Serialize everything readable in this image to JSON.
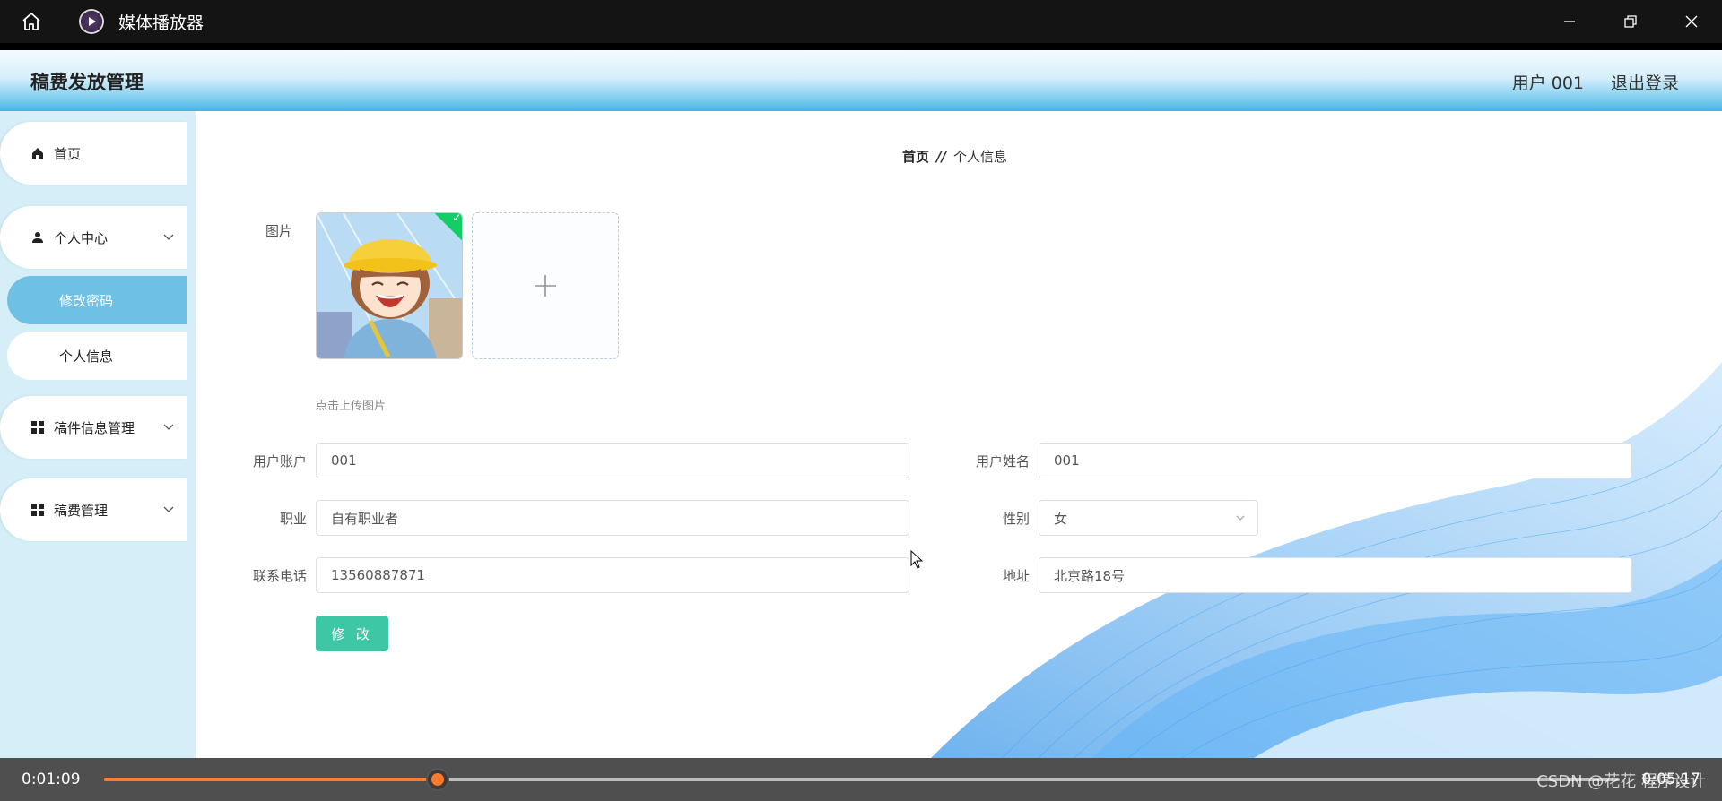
{
  "titlebar": {
    "app_name": "媒体播放器"
  },
  "header": {
    "title": "稿费发放管理",
    "user": "用户 001",
    "logout": "退出登录"
  },
  "sidebar": {
    "home": "首页",
    "personal_center": "个人中心",
    "change_password": "修改密码",
    "personal_info": "个人信息",
    "manuscript_info_mgmt": "稿件信息管理",
    "fee_mgmt": "稿费管理"
  },
  "breadcrumb": {
    "home": "首页",
    "separator": "//",
    "current": "个人信息"
  },
  "form": {
    "image_label": "图片",
    "upload_tip": "点击上传图片",
    "account_label": "用户账户",
    "account_value": "001",
    "name_label": "用户姓名",
    "name_value": "001",
    "job_label": "职业",
    "job_value": "自有职业者",
    "gender_label": "性别",
    "gender_value": "女",
    "phone_label": "联系电话",
    "phone_value": "13560887871",
    "address_label": "地址",
    "address_value": "北京路18号",
    "submit": "修 改"
  },
  "player": {
    "current_time": "0:01:09",
    "total_time": "0:05:17",
    "progress": 0.22,
    "watermark": "CSDN @花花 程序设计"
  },
  "colors": {
    "accent_green": "#3dc7a4",
    "sidebar_active": "#6ec1e4",
    "progress": "#ff7a2b",
    "success_flag": "#13ce66"
  }
}
